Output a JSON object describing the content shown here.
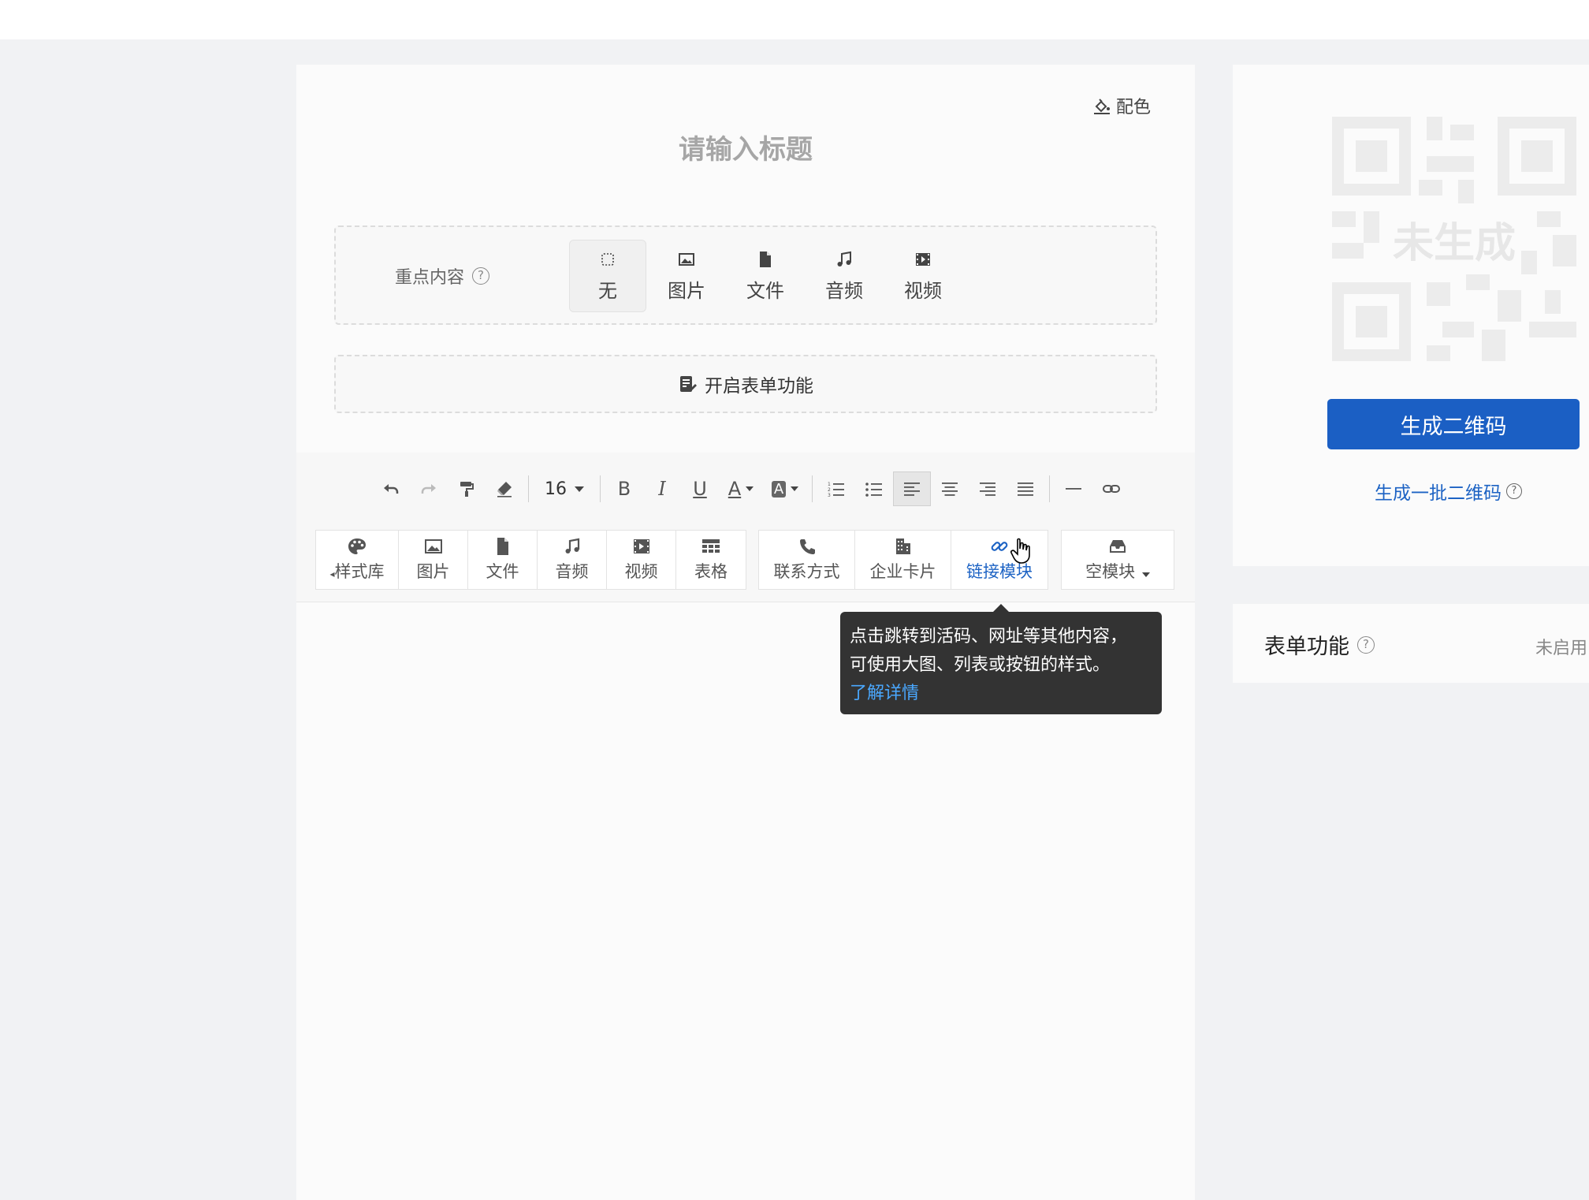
{
  "editor": {
    "theme_label": "配色",
    "title_placeholder": "请输入标题",
    "key_content": {
      "label": "重点内容",
      "options": [
        {
          "label": "无",
          "icon": "dotted-square-icon",
          "active": true
        },
        {
          "label": "图片",
          "icon": "image-icon"
        },
        {
          "label": "文件",
          "icon": "file-icon"
        },
        {
          "label": "音频",
          "icon": "music-note-icon"
        },
        {
          "label": "视频",
          "icon": "video-icon"
        }
      ]
    },
    "form_toggle_label": "开启表单功能",
    "toolbar": {
      "font_size": "16",
      "bold": "B",
      "italic": "I",
      "underline": "U",
      "font_color": "A",
      "bg_color": "A"
    },
    "modules": {
      "group1": [
        {
          "label": "样式库",
          "icon": "palette-icon"
        },
        {
          "label": "图片",
          "icon": "image-icon"
        },
        {
          "label": "文件",
          "icon": "file-icon"
        },
        {
          "label": "音频",
          "icon": "music-note-icon"
        },
        {
          "label": "视频",
          "icon": "video-icon"
        },
        {
          "label": "表格",
          "icon": "table-icon"
        }
      ],
      "group2": [
        {
          "label": "联系方式",
          "icon": "phone-icon"
        },
        {
          "label": "企业卡片",
          "icon": "building-icon"
        },
        {
          "label": "链接模块",
          "icon": "link-icon"
        }
      ],
      "group3": [
        {
          "label": "空模块",
          "icon": "inbox-icon"
        }
      ]
    },
    "tooltip": {
      "line1": "点击跳转到活码、网址等其他内容，",
      "line2": "可使用大图、列表或按钮的样式。",
      "link": "了解详情"
    }
  },
  "qr_panel": {
    "placeholder_text": "未生成",
    "generate_button": "生成二维码",
    "batch_link": "生成一批二维码"
  },
  "form_panel": {
    "title": "表单功能",
    "status": "未启用"
  },
  "colors": {
    "accent": "#1b5fc4",
    "tooltip_bg": "#333333",
    "tooltip_link": "#4aa8ff"
  }
}
